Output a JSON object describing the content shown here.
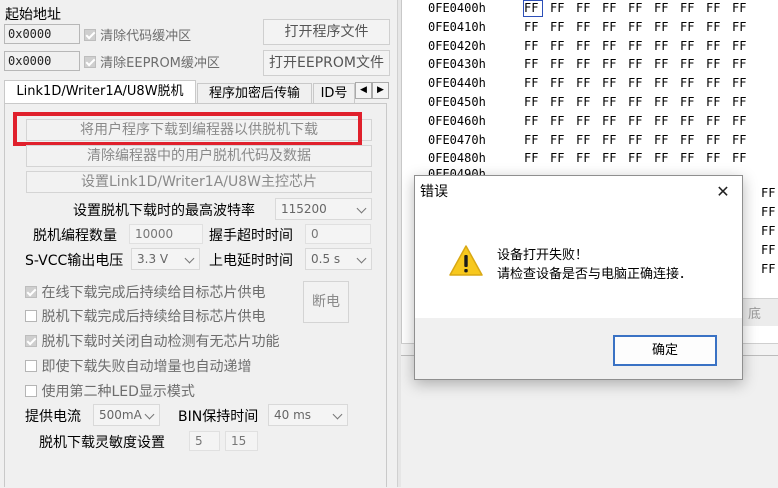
{
  "left": {
    "start_address_label": "起始地址",
    "code_addr_value": "0x0000",
    "eeprom_addr_value": "0x0000",
    "clear_code_buffer_label": "清除代码缓冲区",
    "clear_eeprom_buffer_label": "清除EEPROM缓冲区",
    "open_program_file_button": "打开程序文件",
    "open_eeprom_file_button": "打开EEPROM文件",
    "tabs": [
      {
        "label": "Link1D/Writer1A/U8W脱机",
        "selected": true
      },
      {
        "label": "程序加密后传输",
        "selected": false
      },
      {
        "label": "ID号",
        "selected": false
      }
    ],
    "tab_scroll_left": "◀",
    "tab_scroll_right": "▶",
    "download_user_program_button": "将用户程序下载到编程器以供脱机下载",
    "clear_offline_code_button": "清除编程器中的用户脱机代码及数据",
    "set_master_chip_button": "设置Link1D/Writer1A/U8W主控芯片",
    "max_baud_label": "设置脱机下载时的最高波特率",
    "max_baud_value": "115200",
    "offline_count_label": "脱机编程数量",
    "offline_count_value": "10000",
    "handshake_timeout_label": "握手超时时间",
    "handshake_timeout_value": "0",
    "svcc_label": "S-VCC输出电压",
    "svcc_value": "3.3 V",
    "power_delay_label": "上电延时时间",
    "power_delay_value": "0.5 s",
    "options": [
      {
        "label": "在线下载完成后持续给目标芯片供电",
        "checked": true,
        "disabled": true
      },
      {
        "label": "脱机下载完成后持续给目标芯片供电",
        "checked": false,
        "disabled": true
      },
      {
        "label": "脱机下载时关闭自动检测有无芯片功能",
        "checked": true,
        "disabled": true
      },
      {
        "label": "即使下载失败自动增量也自动递增",
        "checked": false,
        "disabled": true
      },
      {
        "label": "使用第二种LED显示模式",
        "checked": false,
        "disabled": true
      }
    ],
    "power_off_button": "断电",
    "supply_current_label": "提供电流",
    "supply_current_value": "500mA",
    "bin_hold_label": "BIN保持时间",
    "bin_hold_value": "40 ms",
    "sensitivity_label": "脱机下载灵敏度设置",
    "sensitivity_value1": "5",
    "sensitivity_value2": "15"
  },
  "hex": {
    "rows": [
      {
        "addr": "0FE0400h",
        "bytes": [
          "FF",
          "FF",
          "FF",
          "FF",
          "FF",
          "FF",
          "FF",
          "FF",
          "FF"
        ]
      },
      {
        "addr": "0FE0410h",
        "bytes": [
          "FF",
          "FF",
          "FF",
          "FF",
          "FF",
          "FF",
          "FF",
          "FF",
          "FF"
        ]
      },
      {
        "addr": "0FE0420h",
        "bytes": [
          "FF",
          "FF",
          "FF",
          "FF",
          "FF",
          "FF",
          "FF",
          "FF",
          "FF"
        ]
      },
      {
        "addr": "0FE0430h",
        "bytes": [
          "FF",
          "FF",
          "FF",
          "FF",
          "FF",
          "FF",
          "FF",
          "FF",
          "FF"
        ]
      },
      {
        "addr": "0FE0440h",
        "bytes": [
          "FF",
          "FF",
          "FF",
          "FF",
          "FF",
          "FF",
          "FF",
          "FF",
          "FF"
        ]
      },
      {
        "addr": "0FE0450h",
        "bytes": [
          "FF",
          "FF",
          "FF",
          "FF",
          "FF",
          "FF",
          "FF",
          "FF",
          "FF"
        ]
      },
      {
        "addr": "0FE0460h",
        "bytes": [
          "FF",
          "FF",
          "FF",
          "FF",
          "FF",
          "FF",
          "FF",
          "FF",
          "FF"
        ]
      },
      {
        "addr": "0FE0470h",
        "bytes": [
          "FF",
          "FF",
          "FF",
          "FF",
          "FF",
          "FF",
          "FF",
          "FF",
          "FF"
        ]
      },
      {
        "addr": "0FE0480h",
        "bytes": [
          "FF",
          "FF",
          "FF",
          "FF",
          "FF",
          "FF",
          "FF",
          "FF",
          "FF"
        ]
      }
    ],
    "partial_row_addr": "0FE0490h",
    "right_col_cells": [
      "FF",
      "FF",
      "FF",
      "FF",
      "FF"
    ],
    "obscured_button_label": "底"
  },
  "dialog": {
    "title": "错误",
    "close_glyph": "✕",
    "message_line1": "设备打开失败！",
    "message_line2": "请检查设备是否与电脑正确连接．",
    "ok_button": "确定",
    "warning_glyph": "!"
  },
  "colors": {
    "highlight_box": "#e0202c",
    "warning_yellow": "#f7c81e",
    "ok_button_border": "#3a72c4"
  }
}
